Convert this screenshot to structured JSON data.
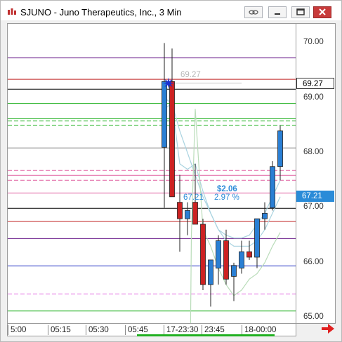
{
  "window": {
    "title": "SJUNO - Juno Therapeutics, Inc., 3 Min"
  },
  "chart_data": {
    "type": "candlestick",
    "ylim": [
      64.9,
      70.35
    ],
    "ticks": [
      "70.00",
      "69.00",
      "68.00",
      "67.00",
      "66.00",
      "65.00"
    ],
    "tick_values": [
      70,
      69,
      68,
      67,
      66,
      65
    ],
    "xlabels": [
      "5:00",
      "05:15",
      "05:30",
      "05:45",
      "17-23:30",
      "23:45",
      "18-00:00"
    ],
    "last_marker": {
      "label": "69.27",
      "value": 69.27
    },
    "current_price": {
      "label": "67.21",
      "value": 67.21
    },
    "annotations": {
      "entry_price": "69.27",
      "ref_price": "67.21",
      "change_dollars": "$2.06",
      "change_percent": "2.97 %"
    },
    "hlines": [
      {
        "value": 69.73,
        "color": "#6a1c8a",
        "dash": false
      },
      {
        "value": 69.34,
        "color": "#c02020",
        "dash": false
      },
      {
        "value": 69.16,
        "color": "#000000",
        "dash": false
      },
      {
        "value": 68.9,
        "color": "#20b020",
        "dash": false
      },
      {
        "value": 68.62,
        "color": "#20b020",
        "dash": false
      },
      {
        "value": 68.58,
        "color": "#20b020",
        "dash": true
      },
      {
        "value": 68.5,
        "color": "#20b020",
        "dash": true
      },
      {
        "value": 68.09,
        "color": "#909090",
        "dash": false
      },
      {
        "value": 67.68,
        "color": "#e060a0",
        "dash": true
      },
      {
        "value": 67.59,
        "color": "#e060a0",
        "dash": false
      },
      {
        "value": 67.5,
        "color": "#e060a0",
        "dash": true
      },
      {
        "value": 67.27,
        "color": "#e060a0",
        "dash": false
      },
      {
        "value": 66.99,
        "color": "#000000",
        "dash": false
      },
      {
        "value": 66.75,
        "color": "#c02020",
        "dash": false
      },
      {
        "value": 66.44,
        "color": "#6a1c8a",
        "dash": false
      },
      {
        "value": 65.94,
        "color": "#1020c0",
        "dash": false
      },
      {
        "value": 65.43,
        "color": "#e060e0",
        "dash": true
      },
      {
        "value": 65.12,
        "color": "#20b020",
        "dash": false
      }
    ],
    "candles": [
      {
        "o": 68.1,
        "h": 70.0,
        "l": 67.0,
        "c": 69.3
      },
      {
        "o": 69.3,
        "h": 69.9,
        "l": 67.4,
        "c": 67.2
      },
      {
        "o": 67.1,
        "h": 67.6,
        "l": 66.2,
        "c": 66.8
      },
      {
        "o": 66.8,
        "h": 67.1,
        "l": 66.5,
        "c": 66.95
      },
      {
        "o": 67.1,
        "h": 67.8,
        "l": 66.7,
        "c": 66.7
      },
      {
        "o": 66.7,
        "h": 66.8,
        "l": 65.5,
        "c": 65.6
      },
      {
        "o": 65.6,
        "h": 66.0,
        "l": 65.2,
        "c": 66.05
      },
      {
        "o": 65.9,
        "h": 66.5,
        "l": 65.6,
        "c": 66.4
      },
      {
        "o": 66.4,
        "h": 66.6,
        "l": 65.6,
        "c": 65.7
      },
      {
        "o": 65.75,
        "h": 66.0,
        "l": 65.3,
        "c": 65.95
      },
      {
        "o": 65.9,
        "h": 66.4,
        "l": 65.8,
        "c": 66.2
      },
      {
        "o": 66.2,
        "h": 66.4,
        "l": 66.05,
        "c": 66.1
      },
      {
        "o": 66.1,
        "h": 66.8,
        "l": 65.9,
        "c": 66.8
      },
      {
        "o": 66.8,
        "h": 67.1,
        "l": 66.6,
        "c": 66.9
      },
      {
        "o": 67.0,
        "h": 67.85,
        "l": 66.95,
        "c": 67.75
      },
      {
        "o": 67.75,
        "h": 68.5,
        "l": 67.5,
        "c": 68.4
      }
    ],
    "band_upper": [
      [
        0,
        68.8
      ],
      [
        1,
        68.9
      ],
      [
        2,
        67.8
      ],
      [
        3,
        67.7
      ],
      [
        4,
        67.8
      ],
      [
        5,
        67.3
      ],
      [
        6,
        66.9
      ],
      [
        7,
        66.6
      ],
      [
        8,
        66.5
      ],
      [
        9,
        66.45
      ],
      [
        10,
        66.45
      ],
      [
        11,
        66.5
      ],
      [
        12,
        66.7
      ],
      [
        13,
        66.9
      ],
      [
        14,
        67.2
      ],
      [
        15,
        67.5
      ]
    ],
    "band_mid": [
      [
        0,
        69.0
      ],
      [
        1,
        68.9
      ],
      [
        2,
        68.4
      ],
      [
        3,
        68.0
      ],
      [
        4,
        67.6
      ],
      [
        5,
        67.2
      ],
      [
        6,
        66.9
      ],
      [
        7,
        66.6
      ],
      [
        8,
        66.4
      ],
      [
        9,
        66.3
      ],
      [
        10,
        66.3
      ],
      [
        11,
        66.3
      ],
      [
        12,
        66.4
      ],
      [
        13,
        66.6
      ],
      [
        14,
        66.9
      ],
      [
        15,
        67.2
      ]
    ],
    "band_lower": [
      [
        3.4,
        64.9
      ],
      [
        3.5,
        66.5
      ],
      [
        4.0,
        68.8
      ],
      [
        5,
        66.6
      ],
      [
        6,
        66.3
      ],
      [
        7,
        65.9
      ],
      [
        8,
        65.6
      ],
      [
        9,
        65.4
      ],
      [
        10,
        65.5
      ],
      [
        11,
        65.7
      ],
      [
        12,
        65.8
      ],
      [
        13,
        66.0
      ],
      [
        14,
        66.3
      ],
      [
        15,
        66.55
      ]
    ]
  }
}
